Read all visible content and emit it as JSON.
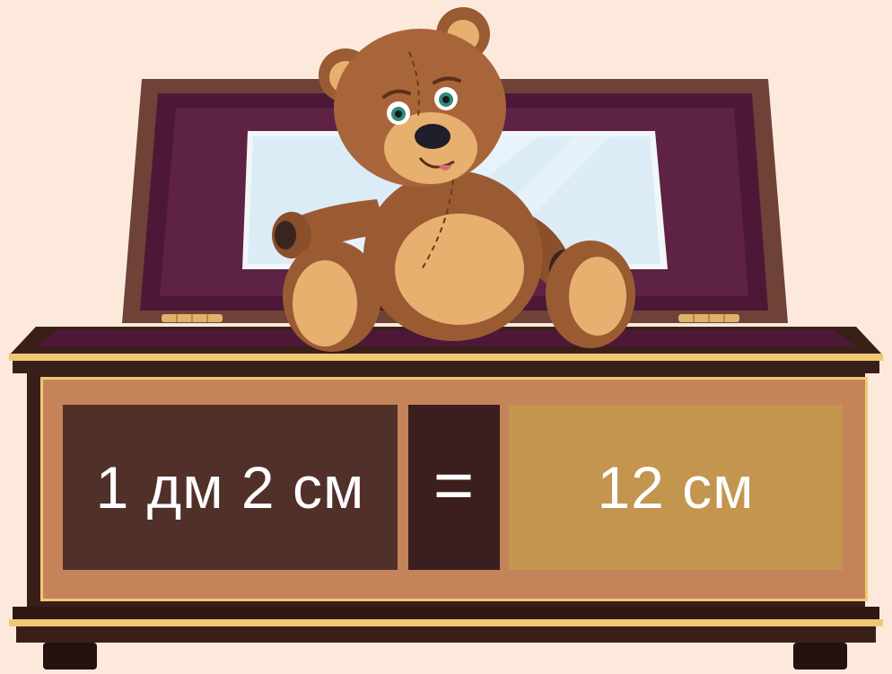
{
  "scene": {
    "palette": {
      "background": "#fce9dc",
      "chest_wood": "#6e4236",
      "chest_dark": "#3a1f19",
      "lid_lining": "#4d1837",
      "trim_gold": "#f0c872",
      "panel_area": "#c5835a",
      "bear_fur": "#9a5b33",
      "bear_muzzle": "#e7b06f"
    },
    "icons": [
      "teddy-bear-icon",
      "music-box-chest-icon",
      "mirror-icon",
      "hinge-icon"
    ]
  },
  "equation": {
    "left": "1 дм 2 см",
    "operator": "=",
    "right": "12 см",
    "colors": {
      "left_card": "#52302a",
      "operator_card": "#3b1f1e",
      "right_card": "#c4954f",
      "text": "#ffffff"
    }
  }
}
